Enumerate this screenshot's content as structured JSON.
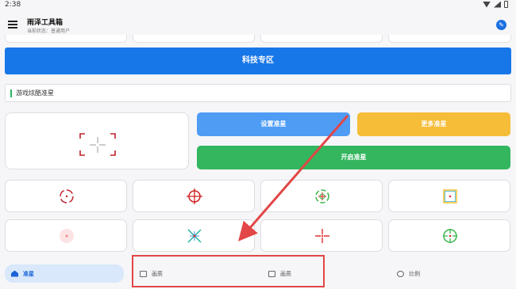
{
  "status": {
    "time": "2:38"
  },
  "app": {
    "title": "雨泽工具箱",
    "subtitle": "当前状态：普通用户"
  },
  "icons": {
    "menu": "menu-icon",
    "wrench": "wrench-icon",
    "crosshair": "crosshair-icon",
    "home": "home-icon",
    "box": "box-icon",
    "face": "face-icon"
  },
  "zone_button": "科技专区",
  "section": {
    "label": "游戏炫酷准星"
  },
  "buttons": {
    "set": "设置准星",
    "more": "更多准星",
    "open": "开启准星"
  },
  "nav": [
    {
      "label": "准星"
    },
    {
      "label": "画质"
    },
    {
      "label": "画质"
    },
    {
      "label": "比例"
    }
  ],
  "colors": {
    "primary": "#1877e8",
    "set": "#4f9cf5",
    "more": "#f6bd39",
    "open": "#33b65e",
    "highlight": "#e24646"
  }
}
